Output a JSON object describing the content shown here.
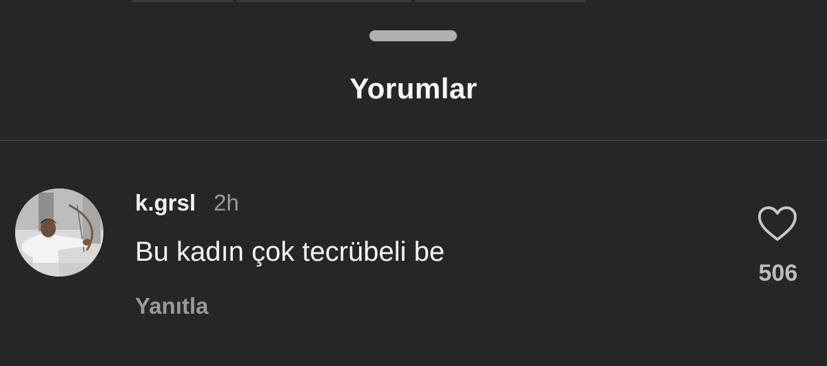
{
  "sheet": {
    "title": "Yorumlar"
  },
  "comment": {
    "username": "k.grsl",
    "timestamp": "2h",
    "text": "Bu kadın çok tecrübeli be",
    "reply_label": "Yanıtla",
    "like_count": "506",
    "like_icon": "heart-outline-icon",
    "avatar_icon": "user-avatar-photo"
  },
  "colors": {
    "background": "#262626",
    "title": "#f7f7f7",
    "muted_text": "#9a9a9a",
    "divider": "#3d3d3d",
    "handle": "#b0b0b0"
  }
}
